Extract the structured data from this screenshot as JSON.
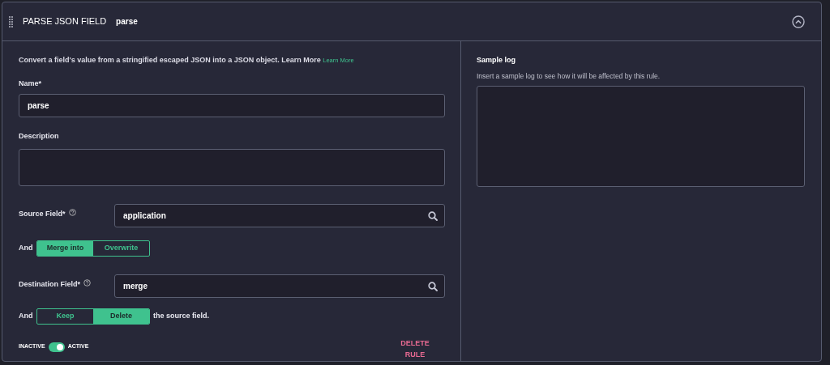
{
  "header": {
    "title": "PARSE JSON FIELD",
    "name": "parse",
    "expanded": true
  },
  "intro": {
    "text": "Convert a field's value from a stringified escaped JSON into a JSON object. Learn More",
    "link": "Learn More"
  },
  "name_field": {
    "label": "Name*",
    "value": "parse"
  },
  "description_field": {
    "label": "Description"
  },
  "source_field": {
    "label": "Source Field*",
    "value": "application"
  },
  "merge_mode": {
    "prefix": "And",
    "options": [
      {
        "label": "Merge into",
        "selected": true
      },
      {
        "label": "Overwrite",
        "selected": false
      }
    ]
  },
  "destination_field": {
    "label": "Destination Field*",
    "value": "merge"
  },
  "source_mode": {
    "prefix": "And",
    "options": [
      {
        "label": "Keep",
        "selected": false
      },
      {
        "label": "Delete",
        "selected": true
      }
    ],
    "suffix": "the source field."
  },
  "status_toggle": {
    "off_label": "INACTIVE",
    "on_label": "ACTIVE",
    "on": true
  },
  "delete_button": "DELETE RULE",
  "sample_log": {
    "title": "Sample log",
    "hint": "Insert a sample log to see how it will be affected by this rule."
  }
}
